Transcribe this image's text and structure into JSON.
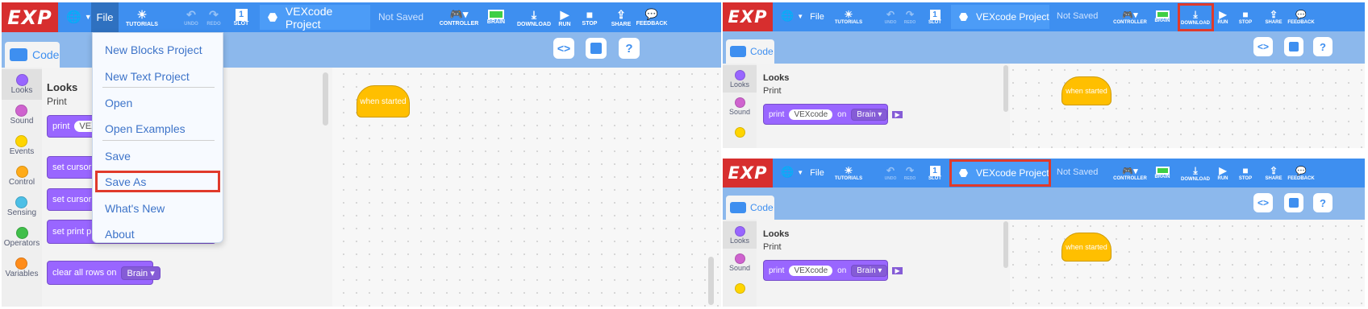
{
  "app": {
    "logo": "EXP",
    "file_label": "File",
    "project_name": "VEXcode Project",
    "save_status": "Not Saved"
  },
  "toolbar": {
    "tutorials": "TUTORIALS",
    "undo": "UNDO",
    "redo": "REDO",
    "slot": "SLOT",
    "slot_number": "1",
    "controller": "CONTROLLER",
    "brain": "BRAIN",
    "download": "DOWNLOAD",
    "run": "RUN",
    "stop": "STOP",
    "share": "SHARE",
    "feedback": "FEEDBACK"
  },
  "code_tab": "Code",
  "categories": [
    "Looks",
    "Sound",
    "Events",
    "Control",
    "Sensing",
    "Operators",
    "Variables"
  ],
  "category_colors": {
    "Looks": "#9966ff",
    "Sound": "#cf63cf",
    "Events": "#ffd500",
    "Control": "#ffab19",
    "Sensing": "#4cbfe6",
    "Operators": "#40bf4a",
    "Variables": "#ff8c1a"
  },
  "flyout": {
    "heading": "Looks",
    "subheading": "Print",
    "print_block": {
      "label": "print",
      "value": "VEXcode",
      "on": "on",
      "target": "Brain"
    },
    "set_cursor": "set cursor to",
    "set_print_pre": "set print pre",
    "clear_rows": {
      "label": "clear all rows on",
      "target": "Brain"
    }
  },
  "hat_block": "when started",
  "file_menu": [
    "New Blocks Project",
    "New Text Project",
    "Open",
    "Open Examples",
    "Save",
    "Save As",
    "What's New",
    "About"
  ],
  "colors": {
    "topbar": "#3e8ff0",
    "logo_bg": "#d72e2e",
    "highlight": "#e03a2b",
    "looks": "#9966ff",
    "event": "#ffbf00"
  }
}
